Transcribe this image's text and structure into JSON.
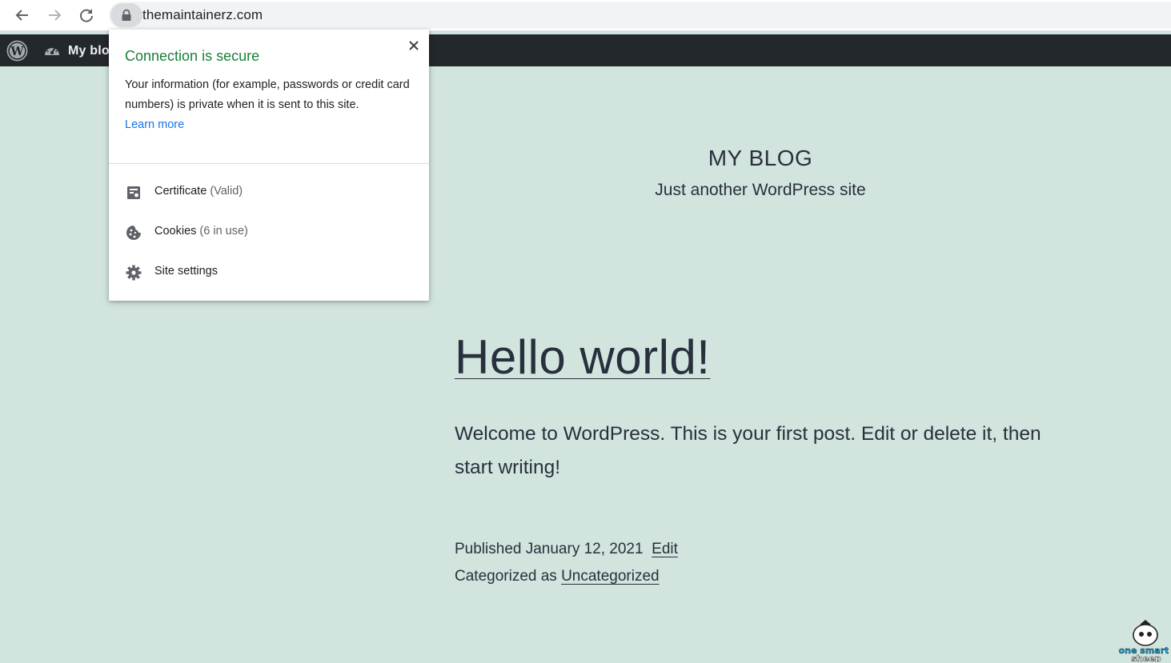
{
  "browser": {
    "url": "themaintainerz.com",
    "back_icon": "arrow-left-icon",
    "forward_icon": "arrow-right-icon",
    "reload_icon": "reload-icon",
    "lock_icon": "lock-icon"
  },
  "admin_bar": {
    "site_name": "My blog",
    "logo_icon": "wordpress-icon",
    "dashboard_icon": "dashboard-icon",
    "background": "#23282d"
  },
  "site": {
    "title": "MY BLOG",
    "description": "Just another WordPress site",
    "background": "#d1e4dd"
  },
  "post": {
    "title": "Hello world!",
    "body": "Welcome to WordPress. This is your first post. Edit or delete it, then start writing!",
    "published_prefix": "Published",
    "published_date": "January 12, 2021",
    "edit_label": "Edit",
    "category_prefix": "Categorized as",
    "category": "Uncategorized"
  },
  "popup": {
    "title": "Connection is secure",
    "title_color": "#188038",
    "body": "Your information (for example, passwords or credit card numbers) is private when it is sent to this site.",
    "learn_more": "Learn more",
    "link_color": "#1a73e8",
    "close_icon": "close-icon",
    "items": [
      {
        "label": "Certificate",
        "sub": "(Valid)",
        "icon": "certificate-icon"
      },
      {
        "label": "Cookies",
        "sub": "(6 in use)",
        "icon": "cookie-icon"
      },
      {
        "label": "Site settings",
        "sub": "",
        "icon": "gear-icon"
      }
    ]
  },
  "watermark": {
    "text_line1": "one smart",
    "text_line2": "sheep"
  }
}
